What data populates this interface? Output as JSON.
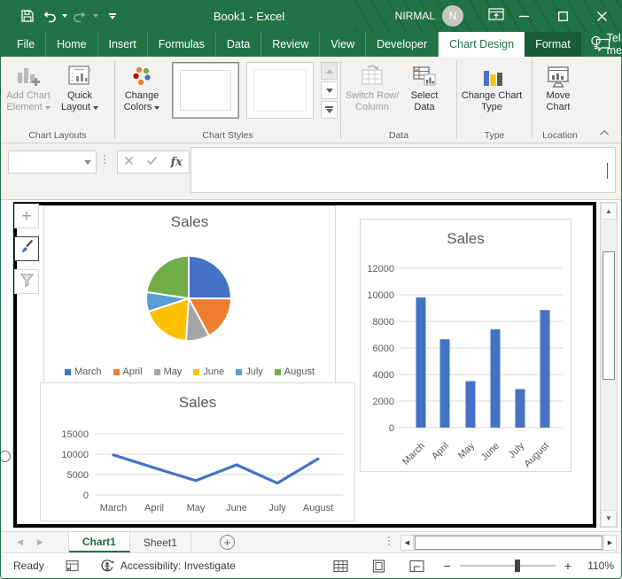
{
  "chrome": {
    "title": "Book1 - Excel",
    "account": "NIRMAL",
    "avatar_initial": "N"
  },
  "glyphs": {
    "undo_note": "undo-arrow",
    "chart_add": "+",
    "add_sheet": "+",
    "scroll_up": "▲",
    "scroll_down": "▼",
    "scroll_left": "◀",
    "scroll_right": "▶",
    "sheet_prev": "◀",
    "sheet_next": "▶",
    "zoom_out": "−",
    "zoom_in": "+",
    "formula_fx": "fx"
  },
  "ribbon_tabs": {
    "items": [
      "File",
      "Home",
      "Insert",
      "Formulas",
      "Data",
      "Review",
      "View",
      "Developer"
    ],
    "active": "Chart Design",
    "contextual": "Format",
    "tell_me": "Tell me"
  },
  "ribbon": {
    "chart_layouts": {
      "label": "Chart Layouts",
      "add_chart_element": "Add Chart Element",
      "quick_layout": "Quick Layout"
    },
    "chart_styles": {
      "label": "Chart Styles",
      "change_colors": "Change Colors"
    },
    "data": {
      "label": "Data",
      "switch_row_column": "Switch Row/ Column",
      "select_data": "Select Data"
    },
    "type": {
      "label": "Type",
      "change_chart_type": "Change Chart Type"
    },
    "location": {
      "label": "Location",
      "move_chart": "Move Chart"
    }
  },
  "sheet_tabs": {
    "tabs": [
      {
        "name": "Chart1",
        "active": true
      },
      {
        "name": "Sheet1",
        "active": false
      }
    ]
  },
  "status_bar": {
    "ready": "Ready",
    "accessibility": "Accessibility: Investigate",
    "zoom_level": "110%"
  },
  "colors": {
    "excel_green": "#217346",
    "contextual_tab_green": "#185C37",
    "series_blue": "#4472C4",
    "gridline": "#d9d9d9",
    "axis_text": "#595959"
  },
  "chart_data": [
    {
      "type": "pie",
      "title": "Sales",
      "categories": [
        "March",
        "April",
        "May",
        "June",
        "July",
        "August"
      ],
      "values": [
        9800,
        6650,
        3500,
        7400,
        2900,
        8850
      ],
      "colors": [
        "#4472C4",
        "#ED7D31",
        "#A5A5A5",
        "#FFC000",
        "#5B9BD5",
        "#70AD47"
      ],
      "legend_position": "bottom"
    },
    {
      "type": "bar",
      "title": "Sales",
      "categories": [
        "March",
        "April",
        "May",
        "June",
        "July",
        "August"
      ],
      "values": [
        9800,
        6650,
        3500,
        7400,
        2900,
        8850
      ],
      "ylim": [
        0,
        12000
      ],
      "yticks": [
        0,
        2000,
        4000,
        6000,
        8000,
        10000,
        12000
      ],
      "bar_color": "#4472C4",
      "grid": true,
      "xlabel_rotation": -45,
      "legend": false
    },
    {
      "type": "line",
      "title": "Sales",
      "categories": [
        "March",
        "April",
        "May",
        "June",
        "July",
        "August"
      ],
      "values": [
        9800,
        6650,
        3500,
        7400,
        2900,
        8850
      ],
      "ylim": [
        0,
        15000
      ],
      "yticks": [
        0,
        5000,
        10000,
        15000
      ],
      "line_color": "#4472C4",
      "grid": true,
      "legend": false
    }
  ]
}
